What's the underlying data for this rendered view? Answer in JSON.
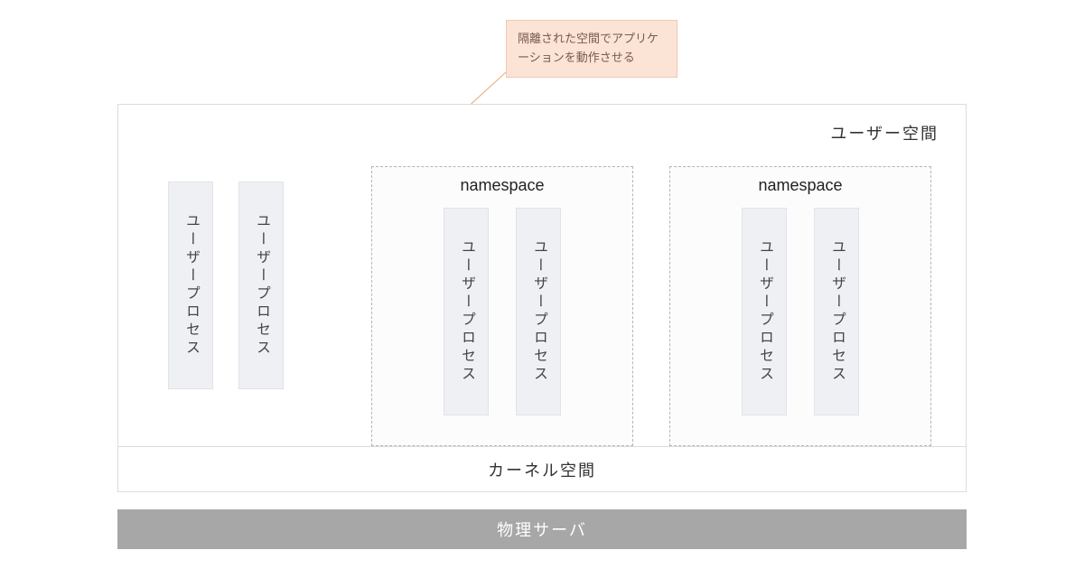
{
  "callout": {
    "text": "隔離された空間でアプリケーションを動作させる"
  },
  "user_space": {
    "label": "ユーザー空間"
  },
  "plain_processes": {
    "p0": "ユーザープロセス",
    "p1": "ユーザープロセス"
  },
  "namespaces": {
    "title": "namespace",
    "n1": {
      "p0": "ユーザープロセス",
      "p1": "ユーザープロセス"
    },
    "n2": {
      "p0": "ユーザープロセス",
      "p1": "ユーザープロセス"
    }
  },
  "kernel_space": {
    "label": "カーネル空間"
  },
  "hardware": {
    "label": "物理サーバ"
  }
}
